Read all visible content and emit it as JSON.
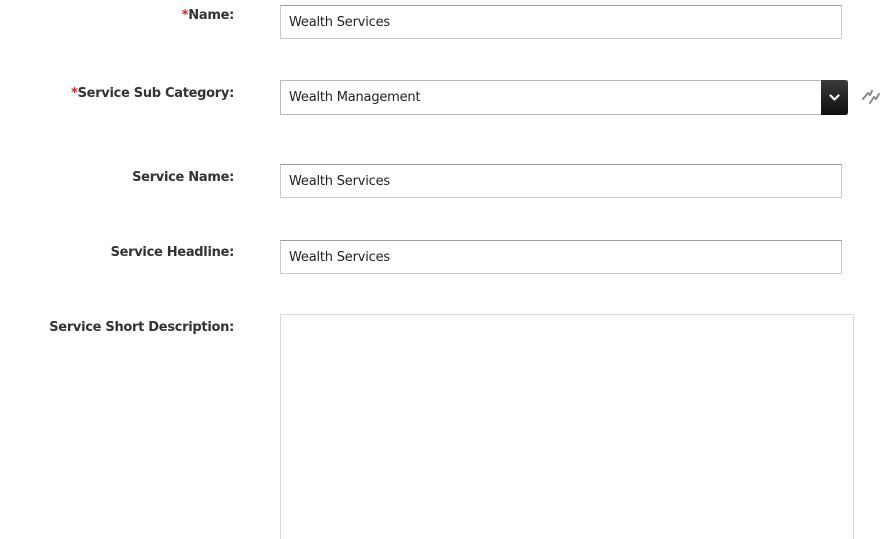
{
  "form": {
    "name": {
      "required_marker": "*",
      "label": "Name:",
      "value": "Wealth Services"
    },
    "service_sub_category": {
      "required_marker": "*",
      "label": "Service Sub Category:",
      "selected": "Wealth Management"
    },
    "service_name": {
      "label": "Service Name:",
      "value": "Wealth Services"
    },
    "service_headline": {
      "label": "Service Headline:",
      "value": "Wealth Services"
    },
    "service_short_description": {
      "label": "Service Short Description:",
      "value": ""
    }
  },
  "icons": {
    "dropdown": "chevron-down-icon",
    "refresh": "refresh-icon"
  },
  "colors": {
    "required": "#d4201c",
    "label": "#333333",
    "dropdown_button": "#1a1a1a"
  }
}
